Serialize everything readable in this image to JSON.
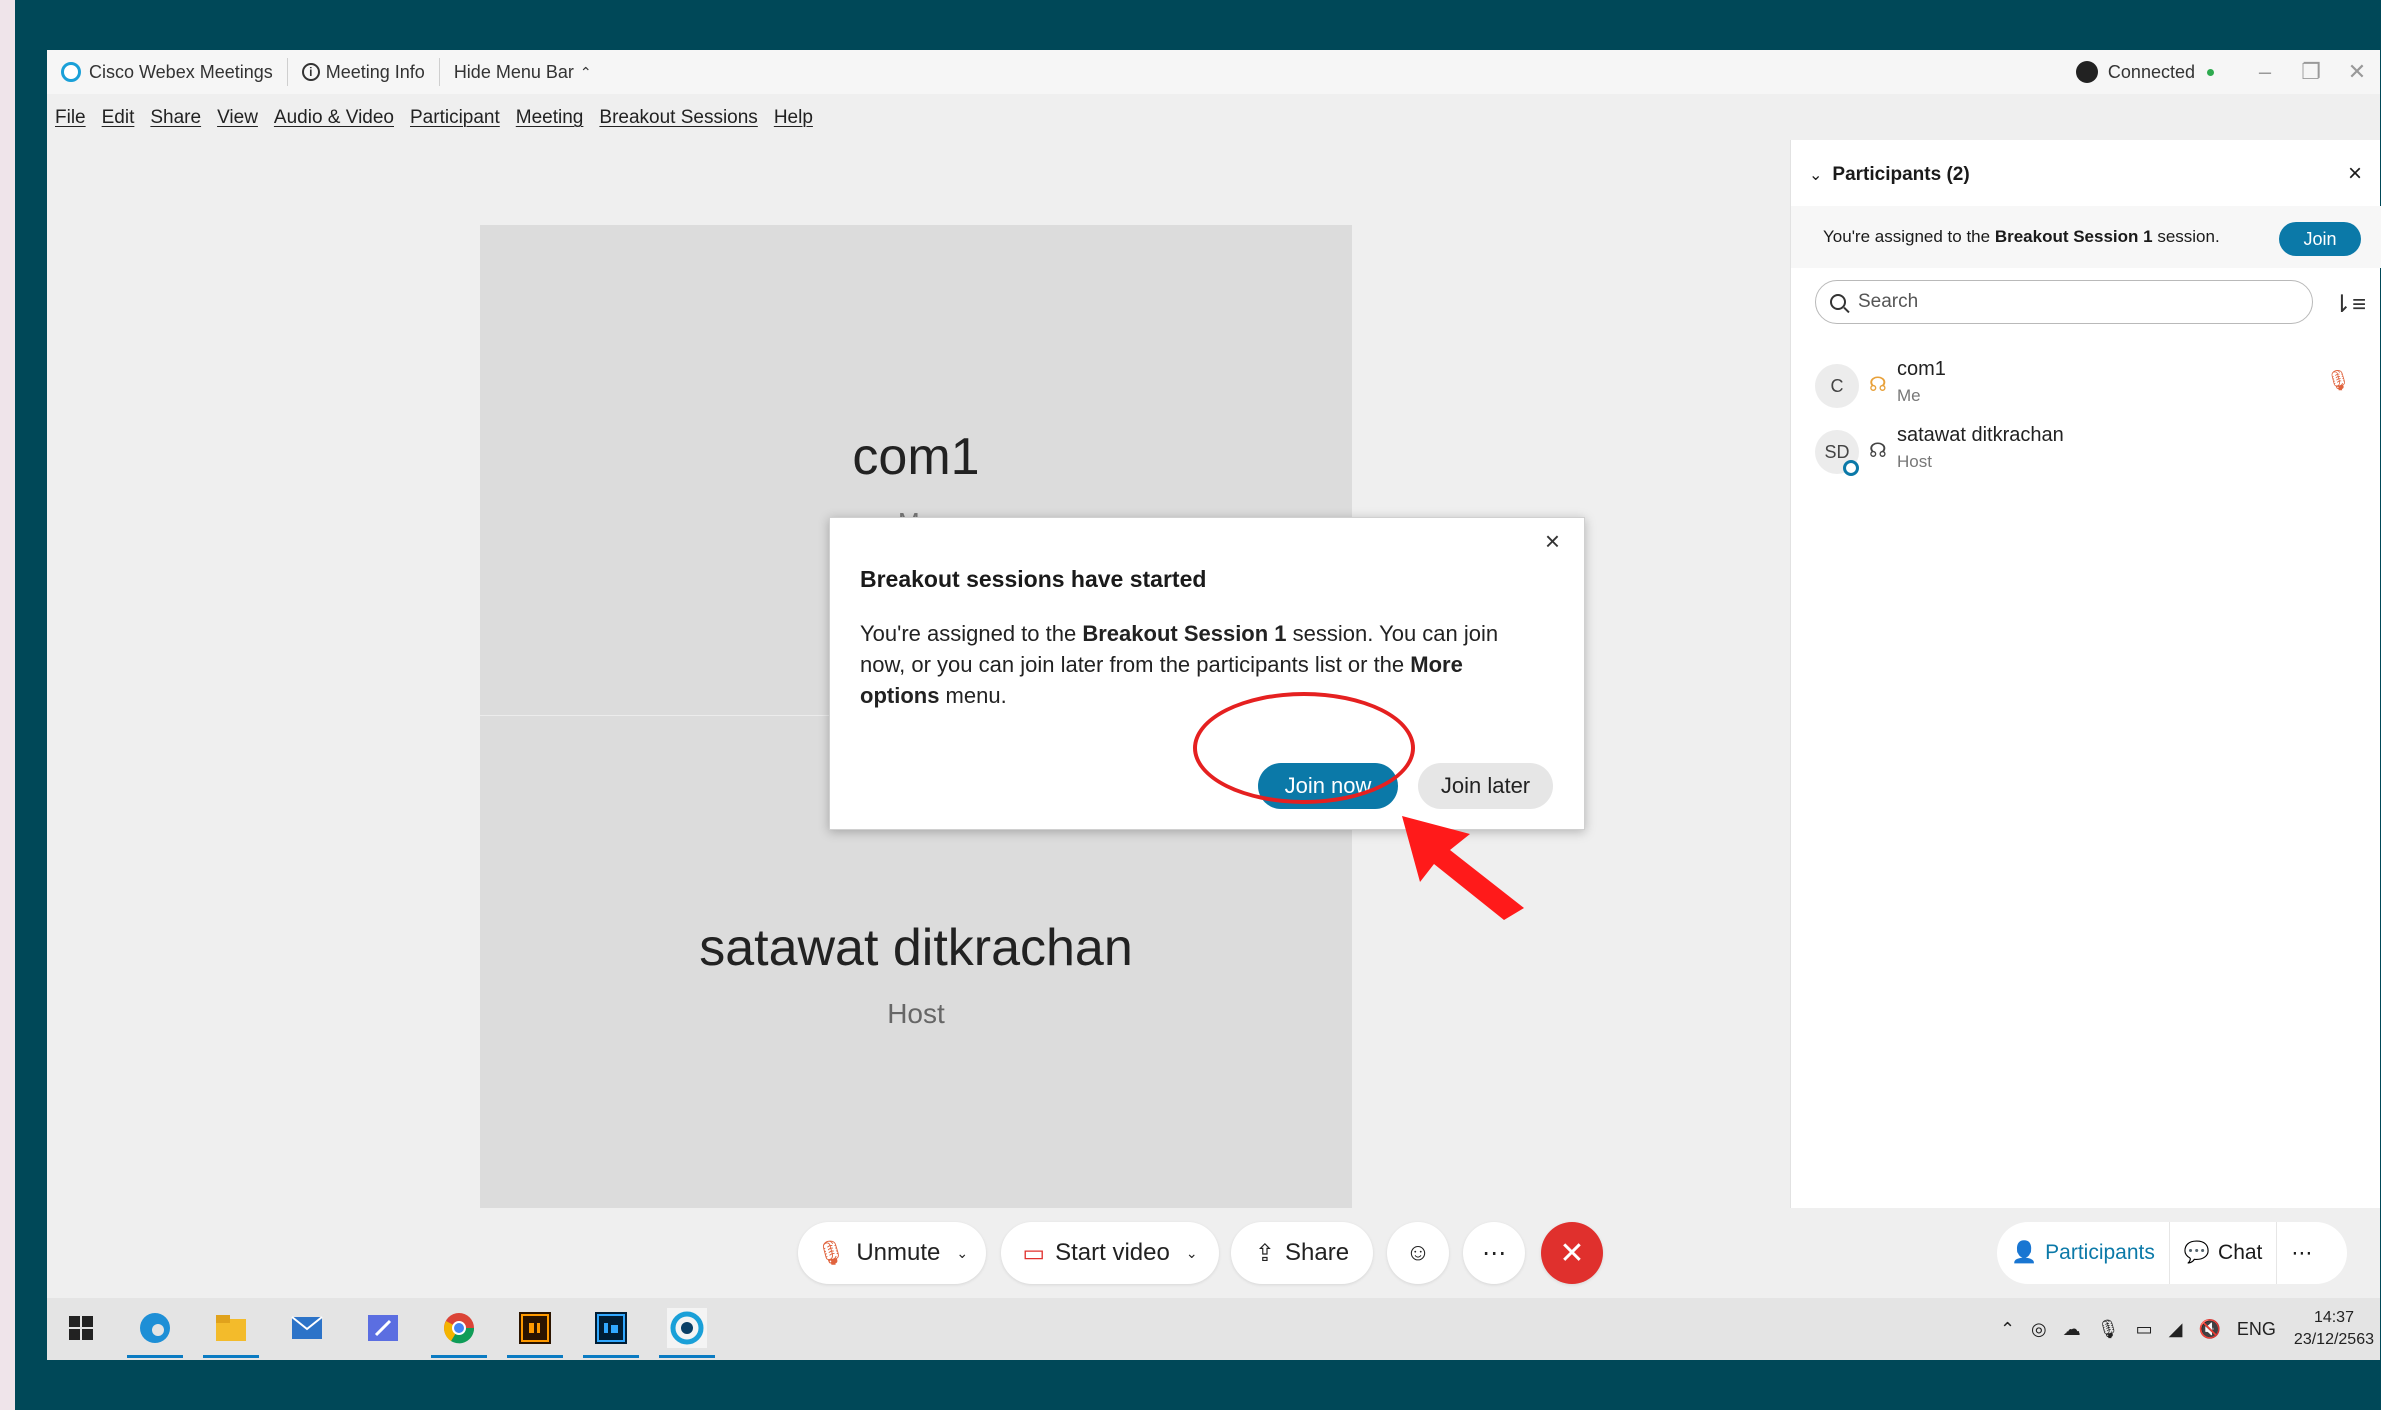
{
  "titlebar": {
    "app_name": "Cisco Webex Meetings",
    "meeting_info": "Meeting Info",
    "hide_menu": "Hide Menu Bar",
    "status": "Connected"
  },
  "menu": [
    "File",
    "Edit",
    "Share",
    "View",
    "Audio & Video",
    "Participant",
    "Meeting",
    "Breakout Sessions",
    "Help"
  ],
  "stage": {
    "tile1_name": "com1",
    "tile1_sub": "Me",
    "tile2_name": "satawat ditkrachan",
    "tile2_sub": "Host"
  },
  "dialog": {
    "title": "Breakout sessions have started",
    "body_1": "You're assigned to the ",
    "body_session": "Breakout Session 1",
    "body_2": " session. You can join now, or you can join later from the participants list or the ",
    "body_more": "More options",
    "body_3": " menu.",
    "join_now": "Join now",
    "join_later": "Join later"
  },
  "panel": {
    "title": "Participants (2)",
    "assign_1": "You're assigned to the ",
    "assign_session": "Breakout Session 1",
    "assign_2": " session.",
    "join": "Join",
    "search_placeholder": "Search",
    "participants": [
      {
        "initials": "C",
        "name": "com1",
        "role": "Me"
      },
      {
        "initials": "SD",
        "name": "satawat ditkrachan",
        "role": "Host"
      }
    ]
  },
  "controls": {
    "unmute": "Unmute",
    "start_video": "Start video",
    "share": "Share",
    "participants": "Participants",
    "chat": "Chat"
  },
  "taskbar": {
    "lang": "ENG",
    "time": "14:37",
    "date": "23/12/2563"
  },
  "colors": {
    "accent": "#0b79a8",
    "end_call": "#e0302d",
    "annotation": "#e52020"
  }
}
